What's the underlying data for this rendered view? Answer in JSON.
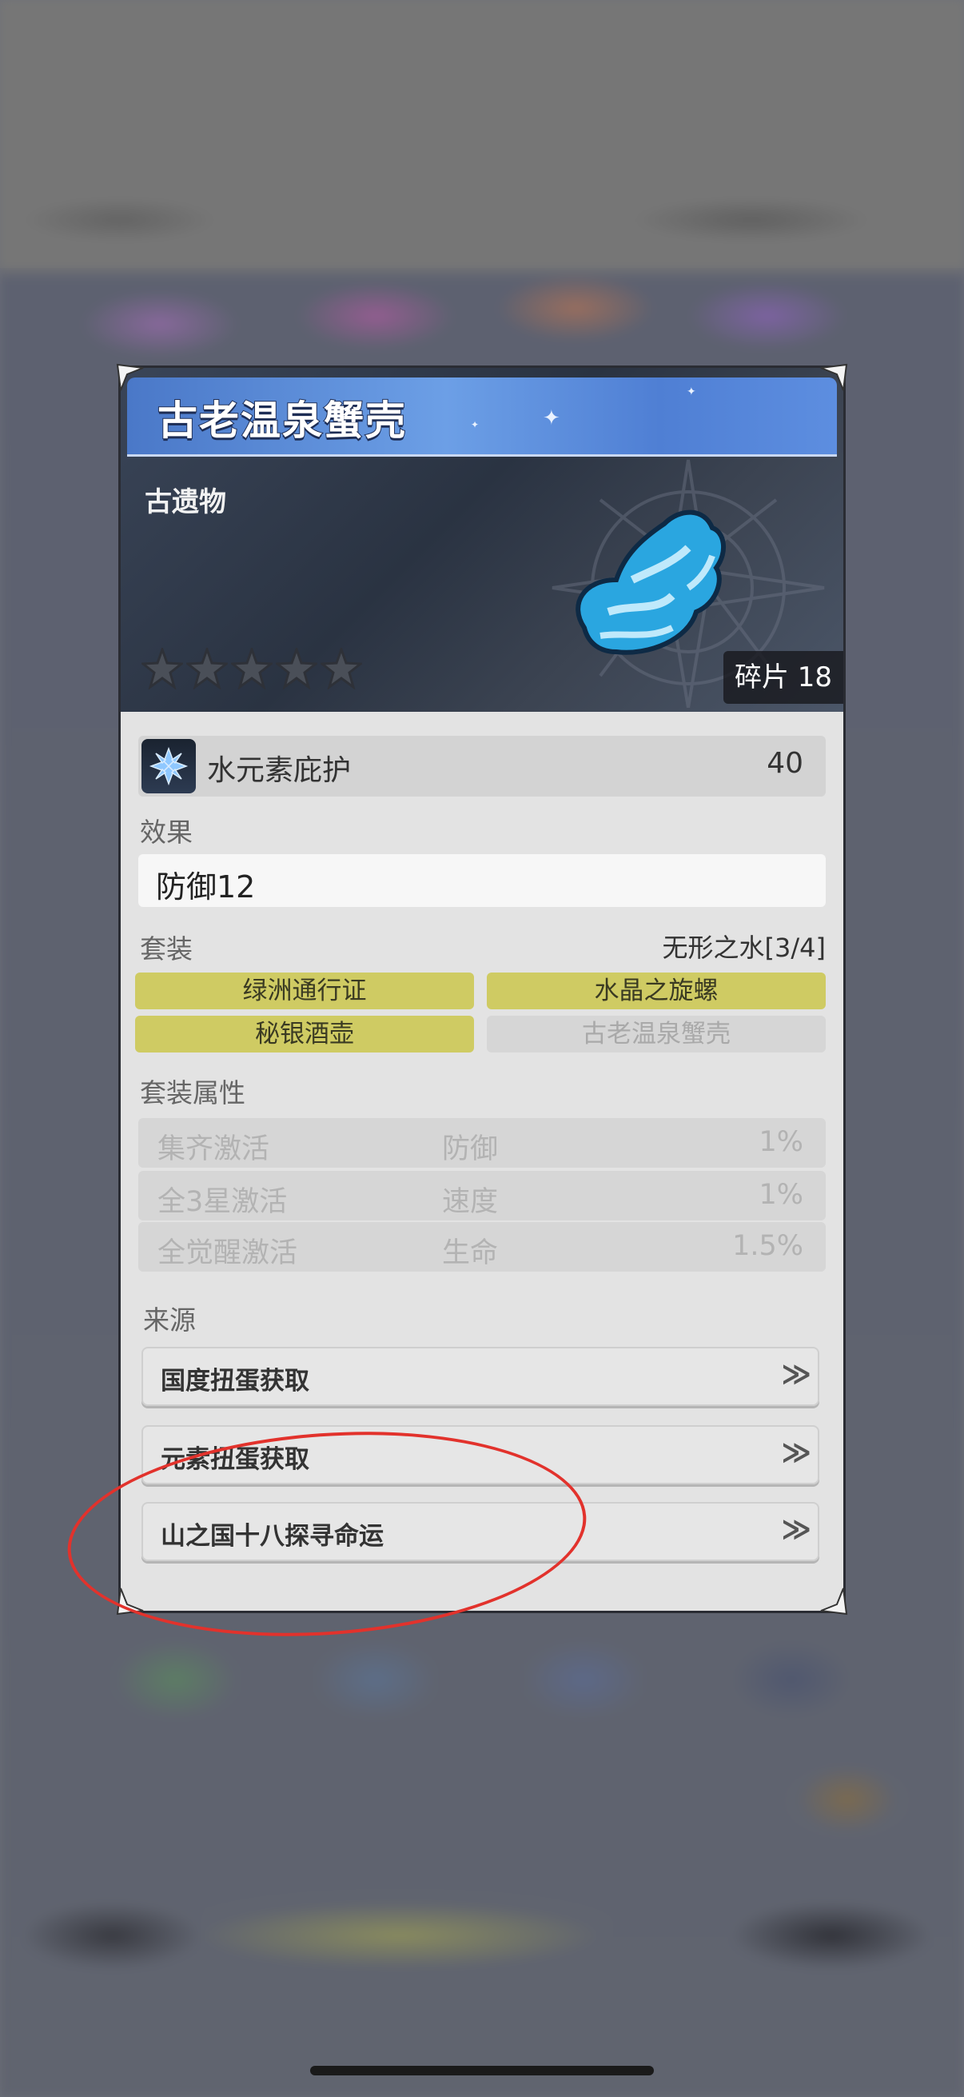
{
  "item": {
    "title": "古老温泉蟹壳",
    "category": "古遗物",
    "rarity_stars": 5,
    "shards_label": "碎片 18"
  },
  "stat": {
    "icon": "water-element-icon",
    "name": "水元素庇护",
    "value": "40"
  },
  "effect": {
    "label": "效果",
    "text": "防御12"
  },
  "set": {
    "label": "套装",
    "name": "无形之水[3/4]",
    "pieces": [
      {
        "label": "绿洲通行证",
        "owned": true
      },
      {
        "label": "水晶之旋螺",
        "owned": true
      },
      {
        "label": "秘银酒壶",
        "owned": true
      },
      {
        "label": "古老温泉蟹壳",
        "owned": false
      }
    ]
  },
  "set_attributes": {
    "label": "套装属性",
    "rows": [
      {
        "condition": "集齐激活",
        "stat": "防御",
        "value": "1%"
      },
      {
        "condition": "全3星激活",
        "stat": "速度",
        "value": "1%"
      },
      {
        "condition": "全觉醒激活",
        "stat": "生命",
        "value": "1.5%"
      }
    ]
  },
  "sources": {
    "label": "来源",
    "items": [
      {
        "label": "国度扭蛋获取"
      },
      {
        "label": "元素扭蛋获取"
      },
      {
        "label": "山之国十八探寻命运"
      }
    ],
    "chevron": "≫"
  },
  "colors": {
    "title_bar": "#5d8ee0",
    "set_owned": "#cfcb63",
    "annotation": "#e2322c"
  }
}
